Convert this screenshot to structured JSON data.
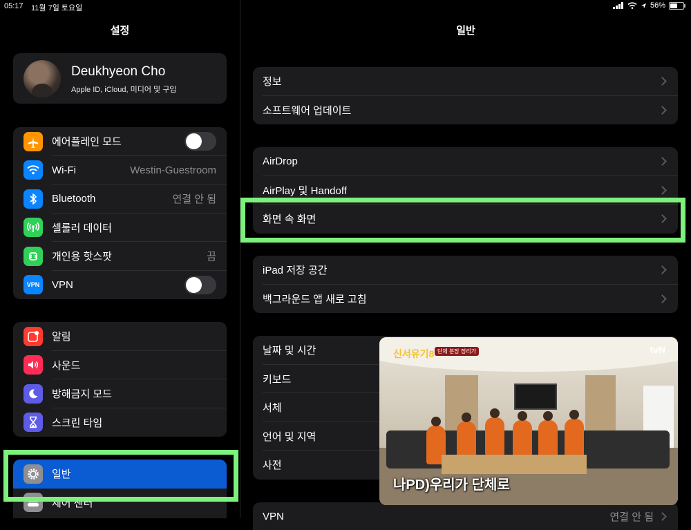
{
  "status_bar": {
    "time": "05:17",
    "date": "11월 7일 토요일",
    "battery": "56%",
    "battery_level": 0.56
  },
  "sidebar": {
    "title": "설정",
    "profile": {
      "name": "Deukhyeon Cho",
      "subtitle": "Apple ID, iCloud, 미디어 및 구입"
    },
    "group1": [
      {
        "label": "에어플레인 모드",
        "icon": "airplane-icon",
        "icon_color": "#ff9500",
        "toggle": false
      },
      {
        "label": "Wi-Fi",
        "icon": "wifi-icon",
        "icon_color": "#0a84ff",
        "value": "Westin-Guestroom"
      },
      {
        "label": "Bluetooth",
        "icon": "bluetooth-icon",
        "icon_color": "#0a84ff",
        "value": "연결 안 됨"
      },
      {
        "label": "셀룰러 데이터",
        "icon": "cellular-icon",
        "icon_color": "#30d158"
      },
      {
        "label": "개인용 핫스팟",
        "icon": "hotspot-icon",
        "icon_color": "#30d158",
        "value": "끔"
      },
      {
        "label": "VPN",
        "icon": "vpn-icon",
        "icon_color": "#0a84ff",
        "icon_text": "VPN",
        "toggle": false
      }
    ],
    "group2": [
      {
        "label": "알림",
        "icon": "notifications-icon",
        "icon_color": "#ff3b30"
      },
      {
        "label": "사운드",
        "icon": "sound-icon",
        "icon_color": "#ff2d55"
      },
      {
        "label": "방해금지 모드",
        "icon": "moon-icon",
        "icon_color": "#5e5ce6"
      },
      {
        "label": "스크린 타임",
        "icon": "hourglass-icon",
        "icon_color": "#5e5ce6"
      }
    ],
    "group3": [
      {
        "label": "일반",
        "icon": "gear-icon",
        "icon_color": "#8e8e93",
        "selected": true
      },
      {
        "label": "제어 센터",
        "icon": "control-center-icon",
        "icon_color": "#8e8e93"
      }
    ]
  },
  "detail": {
    "title": "일반",
    "group1": [
      {
        "label": "정보"
      },
      {
        "label": "소프트웨어 업데이트"
      }
    ],
    "group2": [
      {
        "label": "AirDrop"
      },
      {
        "label": "AirPlay 및 Handoff"
      },
      {
        "label": "화면 속 화면"
      }
    ],
    "group3": [
      {
        "label": "iPad 저장 공간"
      },
      {
        "label": "백그라운드 앱 새로 고침"
      }
    ],
    "group4": [
      {
        "label": "날짜 및 시간"
      },
      {
        "label": "키보드"
      },
      {
        "label": "서체"
      },
      {
        "label": "언어 및 지역"
      },
      {
        "label": "사전"
      }
    ],
    "group5": [
      {
        "label": "VPN",
        "value": "연결 안 됨"
      }
    ]
  },
  "pip": {
    "show_logo": "신서유기8",
    "tag": "단체 분장 정리가",
    "brand": "tvN",
    "caption": "나PD)우리가 단체로"
  },
  "colors": {
    "highlight": "#7cf27c",
    "accent": "#0b5bd3",
    "cell_bg": "#1c1c1e"
  }
}
